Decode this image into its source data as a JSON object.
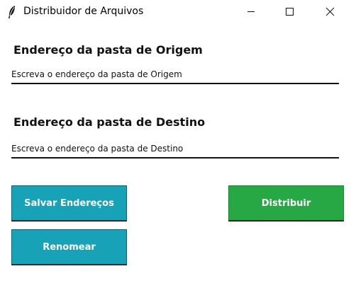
{
  "window": {
    "title": "Distribuidor de Arquivos",
    "icon": "feather-icon",
    "controls": {
      "minimize": "minimize-icon",
      "maximize": "maximize-icon",
      "close": "close-icon"
    }
  },
  "origem": {
    "label": "Endereço da pasta de Origem",
    "placeholder": "Escreva o endereço da pasta de Origem",
    "value": ""
  },
  "destino": {
    "label": "Endereço da pasta de Destino",
    "placeholder": "Escreva o endereço da pasta de Destino",
    "value": ""
  },
  "buttons": {
    "salvar": "Salvar Endereços",
    "distribuir": "Distribuir",
    "renomear": "Renomear"
  },
  "colors": {
    "teal": "#17a2b8",
    "green": "#28a745",
    "text": "#111111"
  }
}
